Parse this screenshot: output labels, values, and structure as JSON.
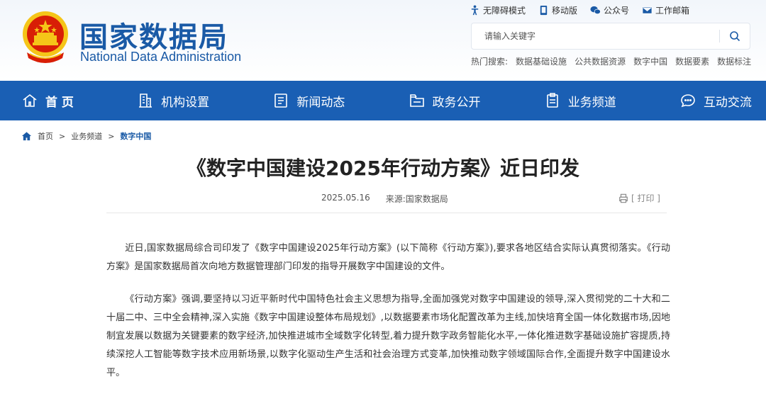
{
  "site": {
    "title_cn": "国家数据局",
    "title_en": "National Data Administration"
  },
  "utility": [
    {
      "label": "无障碍模式",
      "icon": "accessibility-icon"
    },
    {
      "label": "移动版",
      "icon": "mobile-icon"
    },
    {
      "label": "公众号",
      "icon": "wechat-icon"
    },
    {
      "label": "工作邮箱",
      "icon": "mail-icon"
    }
  ],
  "search": {
    "placeholder": "请输入关键字",
    "value": ""
  },
  "hot": {
    "label": "热门搜索:",
    "items": [
      "数据基础设施",
      "公共数据资源",
      "数字中国",
      "数据要素",
      "数据标注"
    ]
  },
  "nav": [
    {
      "label": "首 页",
      "icon": "home-icon"
    },
    {
      "label": "机构设置",
      "icon": "building-icon"
    },
    {
      "label": "新闻动态",
      "icon": "news-icon"
    },
    {
      "label": "政务公开",
      "icon": "folder-icon"
    },
    {
      "label": "业务频道",
      "icon": "clipboard-icon"
    },
    {
      "label": "互动交流",
      "icon": "chat-icon"
    }
  ],
  "breadcrumb": {
    "sep": ">",
    "items": [
      "首页",
      "业务频道",
      "数字中国"
    ]
  },
  "article": {
    "title": "《数字中国建设2025年行动方案》近日印发",
    "date": "2025.05.16",
    "source": "来源:国家数据局",
    "print_label": "[ 打印 ]",
    "paragraphs": [
      "近日,国家数据局综合司印发了《数字中国建设2025年行动方案》(以下简称《行动方案》),要求各地区结合实际认真贯彻落实。《行动方案》是国家数据局首次向地方数据管理部门印发的指导开展数字中国建设的文件。",
      "《行动方案》强调,要坚持以习近平新时代中国特色社会主义思想为指导,全面加强党对数字中国建设的领导,深入贯彻党的二十大和二十届二中、三中全会精神,深入实施《数字中国建设整体布局规划》,以数据要素市场化配置改革为主线,加快培育全国一体化数据市场,因地制宜发展以数据为关键要素的数字经济,加快推进城市全域数字化转型,着力提升数字政务智能化水平,一体化推进数字基础设施扩容提质,持续深挖人工智能等数字技术应用新场景,以数字化驱动生产生活和社会治理方式变革,加快推动数字领域国际合作,全面提升数字中国建设水平。"
    ]
  },
  "colors": {
    "brand": "#1a5aa6",
    "nav_bg": "#1a5fb4",
    "emblem_red": "#d81e06",
    "emblem_gold": "#f5c518"
  }
}
